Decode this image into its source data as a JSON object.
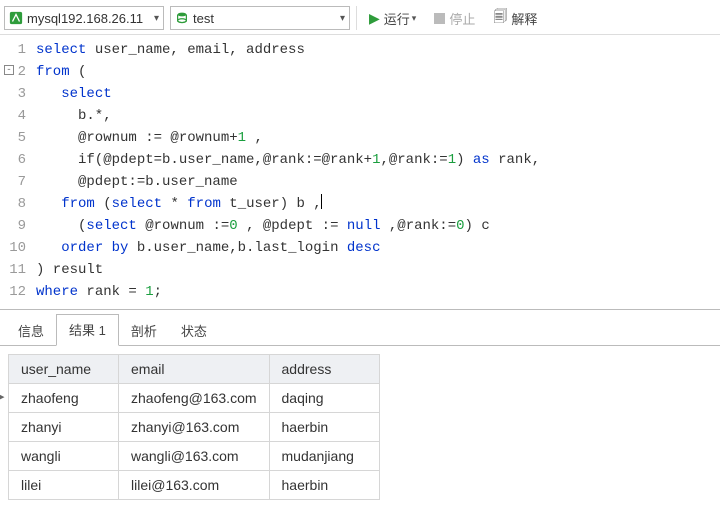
{
  "toolbar": {
    "connection_label": "mysql192.168.26.11",
    "database_label": "test",
    "run_label": "运行",
    "stop_label": "停止",
    "explain_label": "解释"
  },
  "editor": {
    "lines": [
      {
        "n": "1",
        "fold": "",
        "tokens": [
          [
            "kw",
            "select"
          ],
          [
            "",
            " user_name, email, address"
          ]
        ]
      },
      {
        "n": "2",
        "fold": "-",
        "tokens": [
          [
            "kw",
            "from"
          ],
          [
            "",
            " ("
          ]
        ]
      },
      {
        "n": "3",
        "fold": "",
        "tokens": [
          [
            "",
            "   "
          ],
          [
            "kw",
            "select"
          ]
        ]
      },
      {
        "n": "4",
        "fold": "",
        "tokens": [
          [
            "",
            "     b.*,"
          ]
        ]
      },
      {
        "n": "5",
        "fold": "",
        "tokens": [
          [
            "",
            "     @rownum := @rownum+"
          ],
          [
            "num",
            "1"
          ],
          [
            "",
            " ,"
          ]
        ]
      },
      {
        "n": "6",
        "fold": "",
        "tokens": [
          [
            "",
            "     if(@pdept=b.user_name,@rank:=@rank+"
          ],
          [
            "num",
            "1"
          ],
          [
            "",
            ",@rank:="
          ],
          [
            "num",
            "1"
          ],
          [
            "",
            ") "
          ],
          [
            "kw",
            "as"
          ],
          [
            "",
            " rank,"
          ]
        ]
      },
      {
        "n": "7",
        "fold": "",
        "tokens": [
          [
            "",
            "     @pdept:=b.user_name"
          ]
        ]
      },
      {
        "n": "8",
        "fold": "",
        "tokens": [
          [
            "",
            "   "
          ],
          [
            "kw",
            "from"
          ],
          [
            "",
            " ("
          ],
          [
            "kw",
            "select"
          ],
          [
            "",
            " * "
          ],
          [
            "kw",
            "from"
          ],
          [
            "",
            " t_user) b ,"
          ],
          [
            "caret",
            ""
          ]
        ]
      },
      {
        "n": "9",
        "fold": "",
        "tokens": [
          [
            "",
            "     ("
          ],
          [
            "kw",
            "select"
          ],
          [
            "",
            " @rownum :="
          ],
          [
            "num",
            "0"
          ],
          [
            "",
            " , @pdept := "
          ],
          [
            "kw",
            "null"
          ],
          [
            "",
            " ,@rank:="
          ],
          [
            "num",
            "0"
          ],
          [
            "",
            ") c"
          ]
        ]
      },
      {
        "n": "10",
        "fold": "",
        "tokens": [
          [
            "",
            "   "
          ],
          [
            "kw",
            "order by"
          ],
          [
            "",
            " b.user_name,b.last_login "
          ],
          [
            "kw",
            "desc"
          ]
        ]
      },
      {
        "n": "11",
        "fold": "",
        "tokens": [
          [
            "",
            ") result"
          ]
        ]
      },
      {
        "n": "12",
        "fold": "",
        "tokens": [
          [
            "kw",
            "where"
          ],
          [
            "",
            " rank = "
          ],
          [
            "num",
            "1"
          ],
          [
            "",
            ";"
          ]
        ]
      }
    ]
  },
  "tabs": {
    "info": "信息",
    "results1": "结果 1",
    "profile": "剖析",
    "status": "状态",
    "active_index": 1
  },
  "result_table": {
    "columns": [
      "user_name",
      "email",
      "address"
    ],
    "rows": [
      {
        "user_name": "zhaofeng",
        "email": "zhaofeng@163.com",
        "address": "daqing",
        "current": true
      },
      {
        "user_name": "zhanyi",
        "email": "zhanyi@163.com",
        "address": "haerbin",
        "current": false
      },
      {
        "user_name": "wangli",
        "email": "wangli@163.com",
        "address": "mudanjiang",
        "current": false
      },
      {
        "user_name": "lilei",
        "email": "lilei@163.com",
        "address": "haerbin",
        "current": false
      }
    ]
  }
}
